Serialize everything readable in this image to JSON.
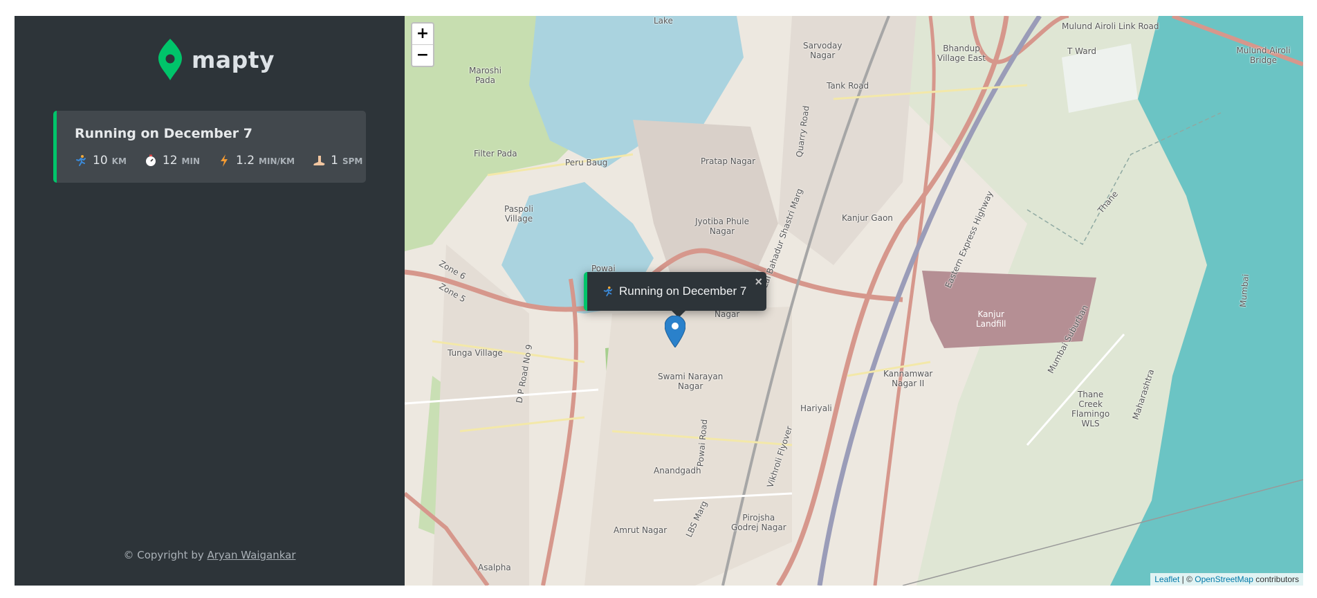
{
  "brand": {
    "name": "mapty",
    "accent": "#00c46a"
  },
  "workouts": [
    {
      "title": "Running on December 7",
      "type": "running",
      "details": [
        {
          "icon": "runner-icon",
          "value": "10",
          "unit": "km"
        },
        {
          "icon": "stopwatch-icon",
          "value": "12",
          "unit": "min"
        },
        {
          "icon": "lightning-icon",
          "value": "1.2",
          "unit": "min/km"
        },
        {
          "icon": "footprint-icon",
          "value": "1",
          "unit": "spm"
        }
      ]
    }
  ],
  "footer": {
    "prefix": "© Copyright by ",
    "author": "Aryan Waigankar"
  },
  "map": {
    "zoom_in": "+",
    "zoom_out": "−",
    "popup": {
      "text": "Running on December 7",
      "close": "×"
    },
    "attribution": {
      "leaflet": "Leaflet",
      "sep": " | © ",
      "osm": "OpenStreetMap",
      "suffix": " contributors"
    },
    "labels": [
      "Lake",
      "Maroshi\nPada",
      "Filter Pada",
      "Peru Baug",
      "Paspoli\nVillage",
      "Powai",
      "Pratap Nagar",
      "Jyotiba Phule\nNagar",
      "Nagar",
      "Sarvoday\nNagar",
      "Tank Road",
      "Bhandup\nVillage East",
      "T Ward",
      "Mulund Airoli Link Road",
      "Mulund Airoli Bridge",
      "Kanjur Gaon",
      "Eastern Express Highway",
      "Kanjur\nLandfill",
      "Kannamwar\nNagar II",
      "Hariyali",
      "Swami Narayan\nNagar",
      "Tunga Village",
      "Anandgadh",
      "Amrut Nagar",
      "Pirojsha\nGodrej Nagar",
      "Thane\nCreek\nFlamingo\nWLS",
      "Asalpha",
      "Zone 6",
      "Zone 5",
      "D P Road No 9",
      "Powai Road",
      "Vikhroli Flyover",
      "LBS Marg",
      "Quarry Road",
      "Lal Bahadur Shastri Marg",
      "Mumbai Suburban",
      "Maharashtra",
      "Mumbai",
      "Thane"
    ]
  }
}
